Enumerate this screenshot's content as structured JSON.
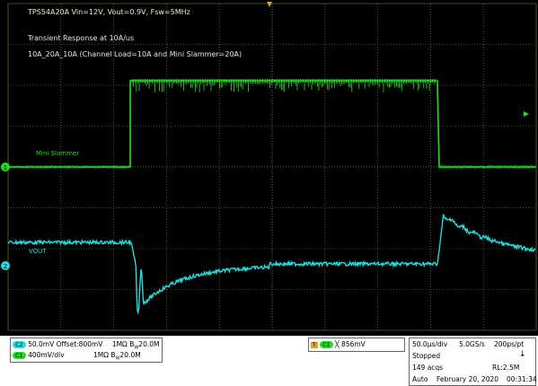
{
  "header": {
    "line1": "TPS54A20A Vin=12V, Vout=0.9V, Fsw=5MHz",
    "line2": "Transient Response at 10A/us",
    "line3": "10A_20A_10A (Channel Load=10A and Mini Slammer=20A)"
  },
  "traces": {
    "ch1": {
      "label": "Mini Slammer",
      "marker": "1",
      "color": "#22dd22"
    },
    "ch2": {
      "label": "VOUT",
      "marker": "2",
      "color": "#22dddd"
    }
  },
  "status": {
    "ch2_chip": "C2",
    "ch2_scale": "50.0mV",
    "ch2_offset": "Offset:800mV",
    "ch2_impedance": "1MΩ",
    "ch2_bw": "20.0M",
    "ch1_chip": "C1",
    "ch1_scale": "400mV/div",
    "ch1_impedance": "1MΩ",
    "ch1_bw": "20.0M",
    "trigger_marker": "T",
    "trigger_chip": "C1",
    "trigger_level": "856mV",
    "timebase": "50.0µs/div",
    "sample_rate": "5.0GS/s",
    "resolution": "200ps/pt",
    "acq_state": "Stopped",
    "acq_count": "149 acqs",
    "record_length": "RL:2.5M",
    "trigger_mode": "Auto",
    "date": "February 20, 2020",
    "time": "00:31:34"
  },
  "colors": {
    "ch1": "#22dd22",
    "ch2": "#22dddd",
    "grid": "#8a8a40",
    "background": "#000000"
  }
}
